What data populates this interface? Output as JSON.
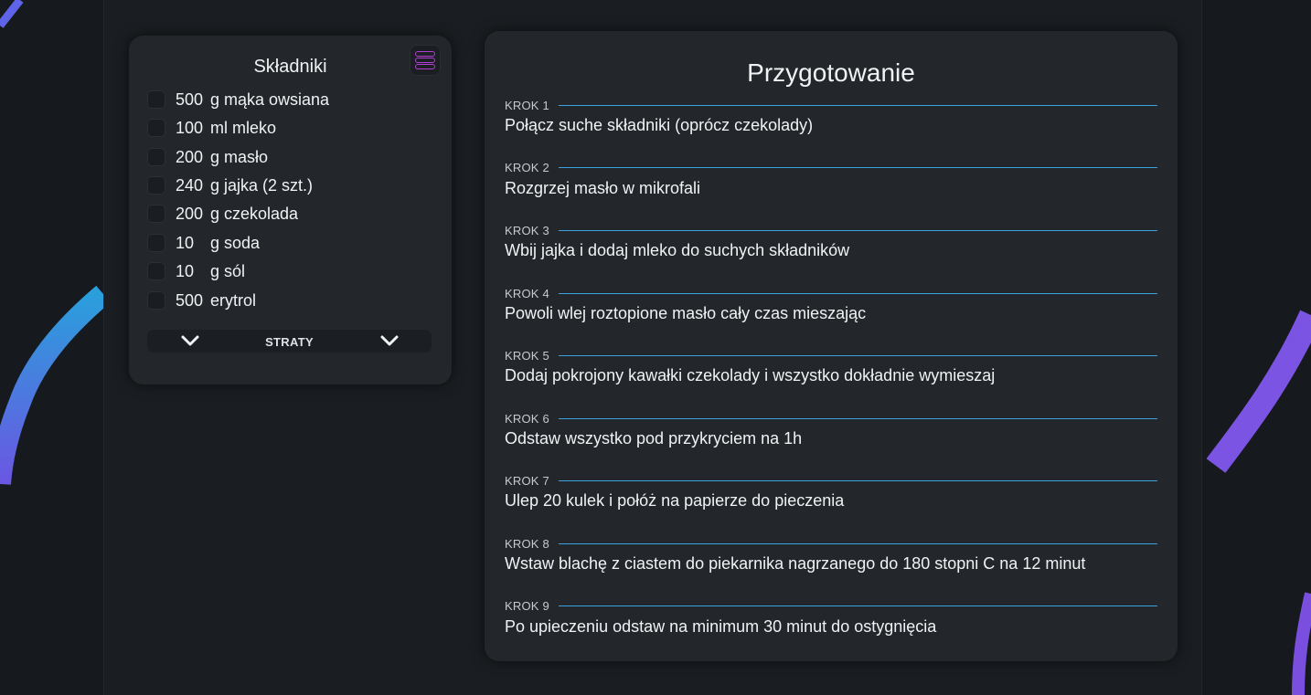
{
  "colors": {
    "accent_line": "#3aa3de",
    "menu_icon": "#b13fd4",
    "card_bg": "#23272b",
    "page_bg": "#16191d"
  },
  "ingredients": {
    "title": "Składniki",
    "menu_icon": "hamburger-icon",
    "items": [
      {
        "qty": "500",
        "name": "g mąka owsiana"
      },
      {
        "qty": "100",
        "name": "ml mleko"
      },
      {
        "qty": "200",
        "name": "g masło"
      },
      {
        "qty": "240",
        "name": "g jajka (2 szt.)"
      },
      {
        "qty": "200",
        "name": "g czekolada"
      },
      {
        "qty": "10",
        "name": "g soda"
      },
      {
        "qty": "10",
        "name": "g sól"
      },
      {
        "qty": "500",
        "name": "erytrol"
      }
    ],
    "straty_label": "STRATY"
  },
  "preparation": {
    "title": "Przygotowanie",
    "steps": [
      {
        "label": "KROK 1",
        "text": "Połącz suche składniki (oprócz czekolady)"
      },
      {
        "label": "KROK 2",
        "text": "Rozgrzej masło w mikrofali"
      },
      {
        "label": "KROK 3",
        "text": "Wbij jajka i dodaj mleko do suchych składników"
      },
      {
        "label": "KROK 4",
        "text": "Powoli wlej roztopione masło cały czas mieszając"
      },
      {
        "label": "KROK 5",
        "text": "Dodaj pokrojony kawałki czekolady i wszystko dokładnie wymieszaj"
      },
      {
        "label": "KROK 6",
        "text": "Odstaw wszystko pod przykryciem na 1h"
      },
      {
        "label": "KROK 7",
        "text": "Ulep 20 kulek i połóż na papierze do pieczenia"
      },
      {
        "label": "KROK 8",
        "text": "Wstaw blachę z ciastem do piekarnika nagrzanego do 180 stopni C na 12 minut"
      },
      {
        "label": "KROK 9",
        "text": "Po upieczeniu odstaw na minimum 30 minut do ostygnięcia"
      }
    ]
  }
}
